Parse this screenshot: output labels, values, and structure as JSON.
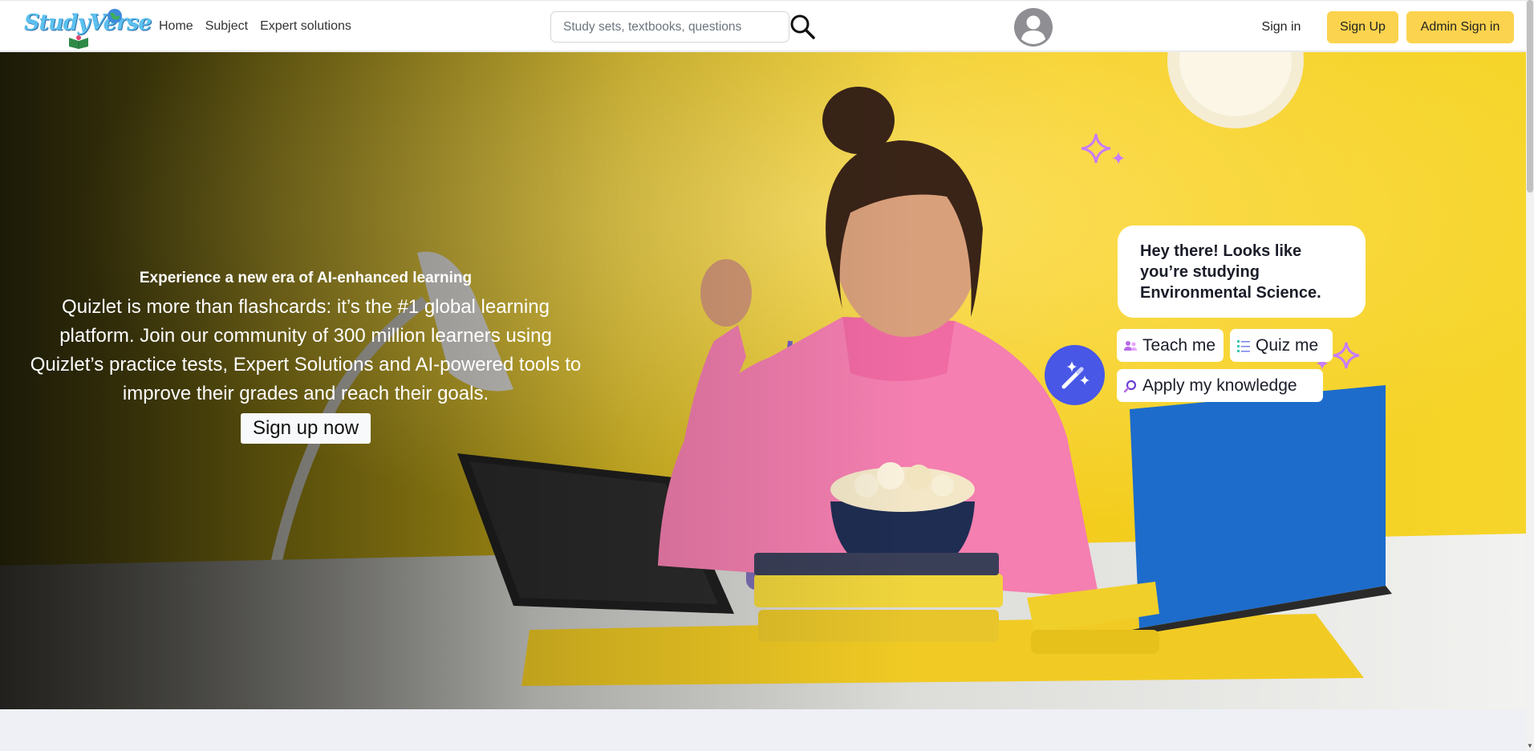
{
  "brand": {
    "logo_text": "StudyVerse"
  },
  "nav": {
    "links": [
      "Home",
      "Subject",
      "Expert solutions"
    ]
  },
  "search": {
    "placeholder": "Study sets, textbooks, questions",
    "value": ""
  },
  "auth": {
    "sign_in": "Sign in",
    "sign_up": "Sign Up",
    "admin_sign_in": "Admin Sign in"
  },
  "hero": {
    "eyebrow": "Experience a new era of AI-enhanced learning",
    "body": "Quizlet is more than flashcards: it’s the #1 global learning platform. Join our community of 300 million learners using Quizlet’s practice tests, Expert Solutions and AI-powered tools to improve their grades and reach their goals.",
    "cta": "Sign up now",
    "chat_message": "Hey there! Looks like you’re studying Environmental Science.",
    "chips": {
      "teach": "Teach me",
      "quiz": "Quiz me",
      "apply": "Apply my knowledge"
    }
  },
  "colors": {
    "accent_yellow": "#fcd34e",
    "hero_yellow": "#f2c51a",
    "magic_blue": "#4857e6",
    "sparkle_purple": "#c77dff",
    "page_background": "#eef0f5"
  }
}
